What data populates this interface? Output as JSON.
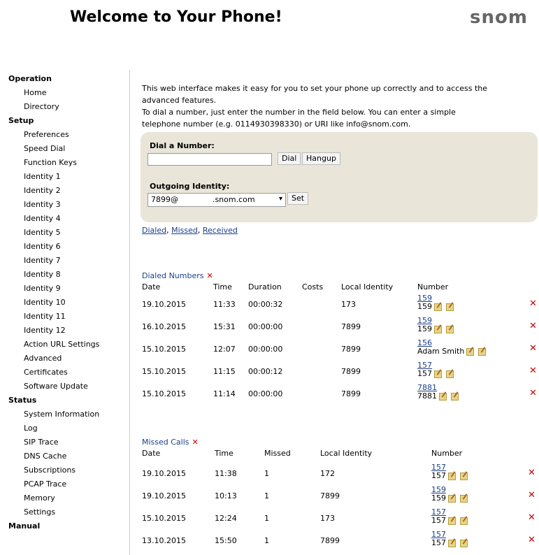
{
  "header": {
    "title": "Welcome to Your Phone!",
    "logo": "snom"
  },
  "sidebar": {
    "sections": [
      {
        "label": "Operation",
        "items": [
          "Home",
          "Directory"
        ]
      },
      {
        "label": "Setup",
        "items": [
          "Preferences",
          "Speed Dial",
          "Function Keys",
          "Identity 1",
          "Identity 2",
          "Identity 3",
          "Identity 4",
          "Identity 5",
          "Identity 6",
          "Identity 7",
          "Identity 8",
          "Identity 9",
          "Identity 10",
          "Identity 11",
          "Identity 12",
          "Action URL Settings",
          "Advanced",
          "Certificates",
          "Software Update"
        ]
      },
      {
        "label": "Status",
        "items": [
          "System Information",
          "Log",
          "SIP Trace",
          "DNS Cache",
          "Subscriptions",
          "PCAP Trace",
          "Memory",
          "Settings"
        ]
      },
      {
        "label": "Manual",
        "items": []
      }
    ]
  },
  "intro": {
    "line1": "This web interface makes it easy for you to set your phone up correctly and to access the",
    "line2": "advanced features.",
    "line3": "To dial a number, just enter the number in the field below. You can enter a simple",
    "line4": "telephone number (e.g. 0114930398330) or URI like info@snom.com."
  },
  "dial": {
    "label": "Dial a Number:",
    "value": "",
    "dial_button": "Dial",
    "hangup_button": "Hangup",
    "identity_label": "Outgoing Identity:",
    "identity_value": "7899@              .snom.com",
    "set_button": "Set"
  },
  "links": {
    "dialed": "Dialed",
    "missed": "Missed",
    "received": "Received",
    "sep": ","
  },
  "dialed": {
    "title": "Dialed Numbers",
    "headers": {
      "date": "Date",
      "time": "Time",
      "duration": "Duration",
      "costs": "Costs",
      "local": "Local Identity",
      "number": "Number"
    },
    "rows": [
      {
        "date": "19.10.2015",
        "time": "11:33",
        "duration": "00:00:32",
        "local": "173",
        "link": "159",
        "name": "159"
      },
      {
        "date": "16.10.2015",
        "time": "15:31",
        "duration": "00:00:00",
        "local": "7899",
        "link": "159",
        "name": "159"
      },
      {
        "date": "15.10.2015",
        "time": "12:07",
        "duration": "00:00:00",
        "local": "7899",
        "link": "156",
        "name": "Adam Smith"
      },
      {
        "date": "15.10.2015",
        "time": "11:15",
        "duration": "00:00:12",
        "local": "7899",
        "link": "157",
        "name": "157"
      },
      {
        "date": "15.10.2015",
        "time": "11:14",
        "duration": "00:00:00",
        "local": "7899",
        "link": "7881",
        "name": "7881"
      }
    ]
  },
  "missed": {
    "title": "Missed Calls",
    "headers": {
      "date": "Date",
      "time": "Time",
      "missed": "Missed",
      "local": "Local Identity",
      "number": "Number"
    },
    "rows": [
      {
        "date": "19.10.2015",
        "time": "11:38",
        "missed": "1",
        "local": "172",
        "link": "157",
        "name": "157"
      },
      {
        "date": "19.10.2015",
        "time": "10:13",
        "missed": "1",
        "local": "7899",
        "link": "159",
        "name": "159"
      },
      {
        "date": "15.10.2015",
        "time": "12:24",
        "missed": "1",
        "local": "173",
        "link": "157",
        "name": "157"
      },
      {
        "date": "13.10.2015",
        "time": "15:50",
        "missed": "1",
        "local": "7899",
        "link": "157",
        "name": "157"
      }
    ]
  },
  "colors": {
    "link": "#1a3f8b",
    "delete": "#cc0000",
    "dialbox": "#e9e5d8"
  }
}
